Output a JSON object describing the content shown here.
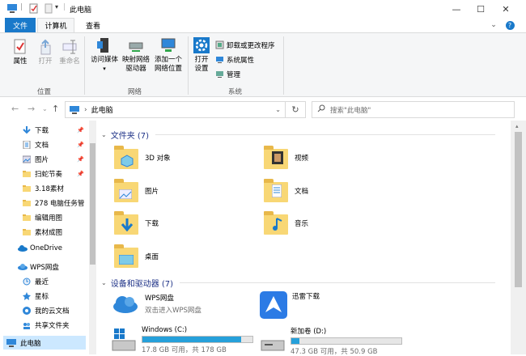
{
  "window": {
    "title": "此电脑",
    "min": "—",
    "max": "☐",
    "close": "✕"
  },
  "tabs": {
    "file": "文件",
    "computer": "计算机",
    "view": "查看",
    "help": "?"
  },
  "ribbon": {
    "properties": "属性",
    "open": "打开",
    "rename": "重命名",
    "group_location": "位置",
    "access_media": "访问媒体",
    "map_drive": "映射网络\n驱动器",
    "add_network": "添加一个\n网络位置",
    "group_network": "网络",
    "open_settings": "打开\n设置",
    "uninstall": "卸载或更改程序",
    "system_props": "系统属性",
    "manage": "管理",
    "group_system": "系统"
  },
  "address": {
    "path": "此电脑",
    "search_placeholder": "搜索\"此电脑\""
  },
  "nav": [
    {
      "label": "下载",
      "icon": "download-icon",
      "pinned": true
    },
    {
      "label": "文档",
      "icon": "document-icon",
      "pinned": true
    },
    {
      "label": "图片",
      "icon": "picture-icon",
      "pinned": true
    },
    {
      "label": "扫蛇节奏",
      "icon": "folder-icon",
      "pinned": true
    },
    {
      "label": "3.18素材",
      "icon": "folder-icon",
      "pinned": false
    },
    {
      "label": "278 电脑任务管",
      "icon": "folder-icon",
      "pinned": false
    },
    {
      "label": "编辑用图",
      "icon": "folder-icon",
      "pinned": false
    },
    {
      "label": "素材成图",
      "icon": "folder-icon",
      "pinned": false
    },
    {
      "label": "OneDrive",
      "icon": "onedrive-icon",
      "pinned": false
    },
    {
      "label": "WPS网盘",
      "icon": "wps-cloud-icon",
      "pinned": false
    },
    {
      "label": "最近",
      "icon": "clock-icon",
      "pinned": false
    },
    {
      "label": "星标",
      "icon": "star-icon",
      "pinned": false
    },
    {
      "label": "我的云文档",
      "icon": "cloud-doc-icon",
      "pinned": false
    },
    {
      "label": "共享文件夹",
      "icon": "share-icon",
      "pinned": false
    },
    {
      "label": "此电脑",
      "icon": "pc-icon",
      "pinned": false
    }
  ],
  "folders_header": "文件夹 (7)",
  "folders": [
    {
      "label": "3D 对象",
      "icon": "3d-objects-icon"
    },
    {
      "label": "视频",
      "icon": "video-folder-icon"
    },
    {
      "label": "图片",
      "icon": "pictures-folder-icon"
    },
    {
      "label": "文档",
      "icon": "documents-folder-icon"
    },
    {
      "label": "下载",
      "icon": "downloads-folder-icon"
    },
    {
      "label": "音乐",
      "icon": "music-folder-icon"
    },
    {
      "label": "桌面",
      "icon": "desktop-folder-icon"
    }
  ],
  "devices_header": "设备和驱动器 (7)",
  "apps": [
    {
      "name": "WPS网盘",
      "sub": "双击进入WPS网盘",
      "icon": "wps-cloud-icon"
    },
    {
      "name": "迅雷下载",
      "sub": "",
      "icon": "xunlei-icon"
    }
  ],
  "drives": [
    {
      "name": "Windows (C:)",
      "free": "17.8 GB 可用，共 178 GB",
      "used_fraction": 0.9
    },
    {
      "name": "新加卷 (D:)",
      "free": "47.3 GB 可用，共 50.9 GB",
      "used_fraction": 0.07
    }
  ],
  "colors": {
    "accent": "#1979ca",
    "bar": "#26a0da",
    "header": "#1e3287"
  }
}
